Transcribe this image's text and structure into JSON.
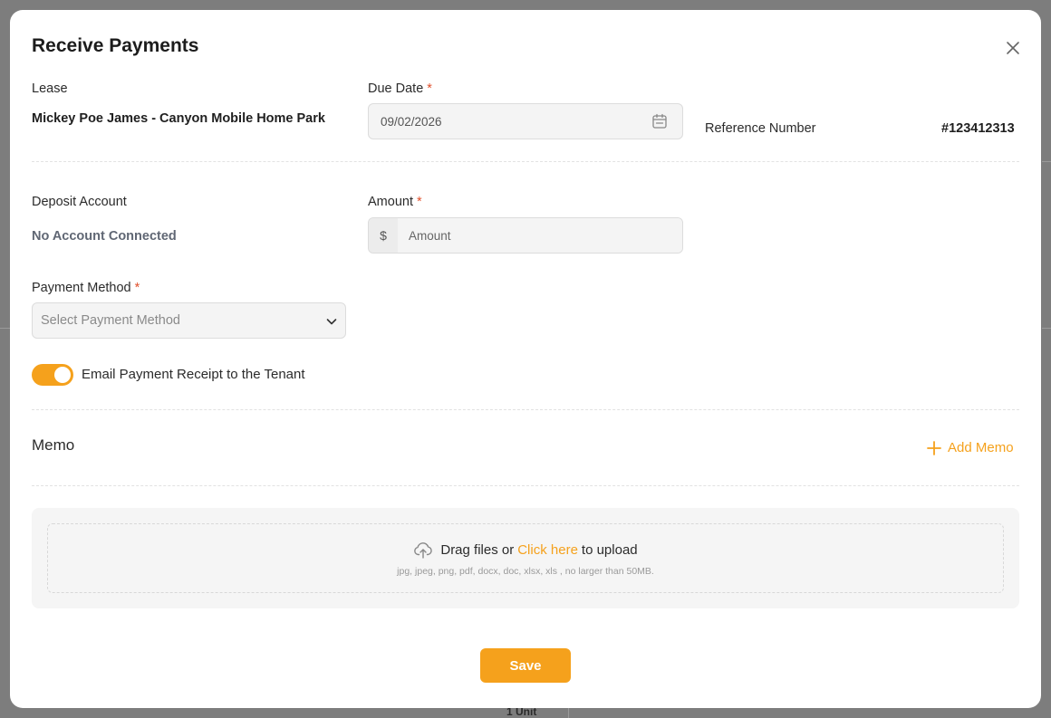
{
  "modal": {
    "title": "Receive Payments",
    "close_icon": "close-icon"
  },
  "lease": {
    "label": "Lease",
    "value": "Mickey Poe James - Canyon Mobile Home Park"
  },
  "due_date": {
    "label": "Due Date",
    "required_mark": "*",
    "value": "09/02/2026",
    "icon": "calendar-icon"
  },
  "reference": {
    "label": "Reference Number",
    "value": "#123412313"
  },
  "deposit": {
    "label": "Deposit Account",
    "value": "No Account Connected"
  },
  "amount": {
    "label": "Amount",
    "required_mark": "*",
    "prefix": "$",
    "placeholder": "Amount"
  },
  "payment_method": {
    "label": "Payment Method",
    "required_mark": "*",
    "placeholder": "Select Payment Method",
    "icon": "chevron-down-icon"
  },
  "email_toggle": {
    "label": "Email Payment Receipt to the Tenant",
    "enabled": true
  },
  "memo": {
    "label": "Memo",
    "add_label": "Add Memo",
    "add_icon": "plus-icon"
  },
  "upload": {
    "icon": "cloud-upload-icon",
    "text_before": "Drag files or",
    "link": "Click here",
    "text_after": "to upload",
    "hint": "jpg, jpeg, png, pdf, docx, doc, xlsx, xls , no larger than 50MB."
  },
  "save_label": "Save",
  "background": {
    "bottom_text": "1 Unit"
  },
  "colors": {
    "accent": "#f5a11c",
    "required": "#e0502c",
    "overlay": "#7d7d7d"
  }
}
